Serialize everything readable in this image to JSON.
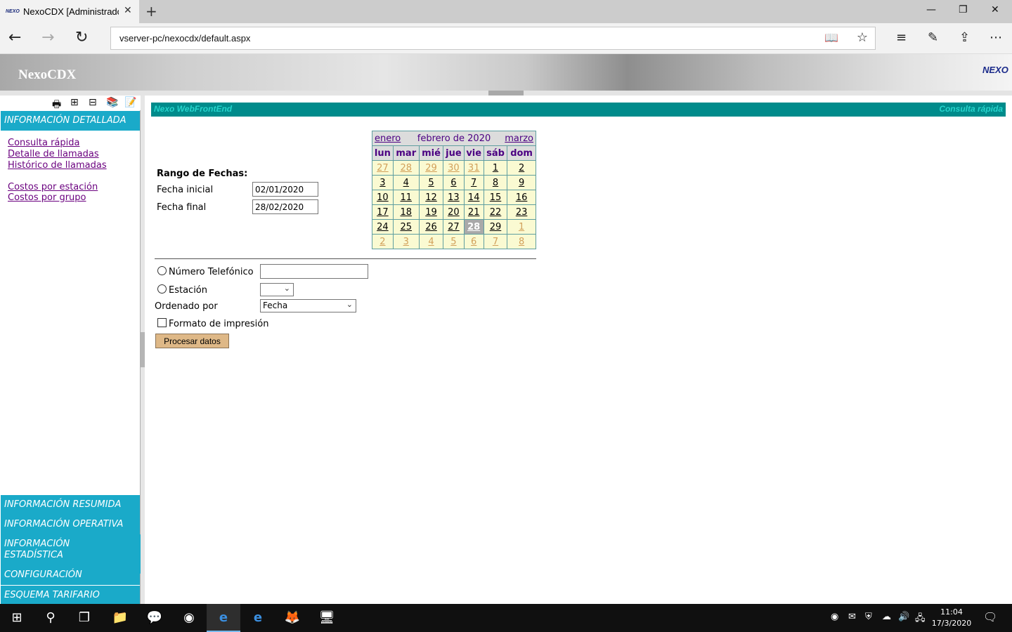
{
  "browser": {
    "tab_title": "NexoCDX [Administrador]",
    "favicon_text": "NEXO",
    "close_glyph": "✕",
    "new_tab_glyph": "+",
    "window": {
      "minimize": "—",
      "maximize": "❐",
      "close": "✕"
    },
    "url": "vserver-pc/nexocdx/default.aspx",
    "nav": {
      "back": "←",
      "forward": "→",
      "refresh": "↻"
    },
    "url_icons": {
      "reader": "📖",
      "favorite": "☆"
    },
    "toolbar": {
      "hub": "≡",
      "notes": "✎",
      "share": "⇪",
      "more": "⋯"
    }
  },
  "app": {
    "brand": "NexoCDX",
    "logo": "NEXO",
    "banner_left": "Nexo WebFrontEnd",
    "banner_right": "Consulta rápida"
  },
  "sidebar": {
    "tools": [
      "🖶",
      "⊞",
      "⊟",
      "📚",
      "📝"
    ],
    "active_section": "INFORMACIÓN DETALLADA",
    "links_group1": [
      "Consulta rápida",
      "Detalle de llamadas",
      "Histórico de llamadas"
    ],
    "links_group2": [
      "Costos por estación",
      "Costos por grupo"
    ],
    "sections": [
      "INFORMACIÓN RESUMIDA",
      "INFORMACIÓN OPERATIVA",
      "INFORMACIÓN ESTADÍSTICA",
      "CONFIGURACIÓN",
      "ESQUEMA TARIFARIO"
    ]
  },
  "form": {
    "range_title": "Rango de Fechas:",
    "start_label": "Fecha inicial",
    "start_value": "02/01/2020",
    "end_label": "Fecha final",
    "end_value": "28/02/2020",
    "phone_label": "Número Telefónico",
    "phone_value": "",
    "station_label": "Estación",
    "station_value": "",
    "order_label": "Ordenado por",
    "order_value": "Fecha",
    "print_label": "Formato de impresión",
    "submit_label": "Procesar datos"
  },
  "calendar": {
    "prev": "enero",
    "title": "febrero de 2020",
    "next": "marzo",
    "weekdays": [
      "lun",
      "mar",
      "mié",
      "jue",
      "vie",
      "sáb",
      "dom"
    ],
    "weeks": [
      [
        "27",
        "28",
        "29",
        "30",
        "31",
        "1",
        "2"
      ],
      [
        "3",
        "4",
        "5",
        "6",
        "7",
        "8",
        "9"
      ],
      [
        "10",
        "11",
        "12",
        "13",
        "14",
        "15",
        "16"
      ],
      [
        "17",
        "18",
        "19",
        "20",
        "21",
        "22",
        "23"
      ],
      [
        "24",
        "25",
        "26",
        "27",
        "28",
        "29",
        "1"
      ],
      [
        "2",
        "3",
        "4",
        "5",
        "6",
        "7",
        "8"
      ]
    ],
    "selected": "28"
  },
  "taskbar": {
    "start": "⊞",
    "search": "⚲",
    "taskview": "❐",
    "apps": [
      "📁",
      "💬",
      "◉",
      "e",
      "e",
      "🦊",
      "🖥"
    ],
    "tray": [
      "◉",
      "✉",
      "⛨",
      "☁",
      "🔊",
      "🖧"
    ],
    "time": "11:04",
    "date": "17/3/2020",
    "notifications": "🗨"
  }
}
